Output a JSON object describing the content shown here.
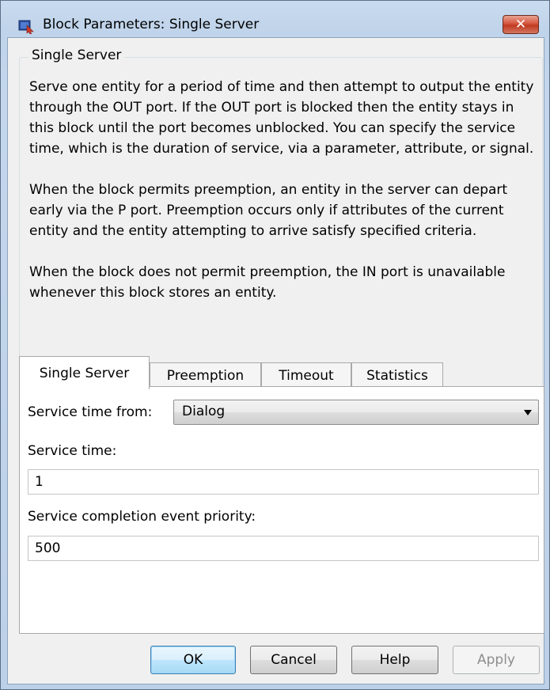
{
  "window": {
    "title": "Block Parameters: Single Server",
    "close_label": "✕"
  },
  "group": {
    "title": "Single Server",
    "paragraphs": [
      "Serve one entity for a period of time and then attempt to output the entity through the OUT port. If the OUT port is blocked then the entity stays in this block until the port becomes unblocked. You can specify the service time, which is the duration of service, via a parameter, attribute, or signal.",
      "When the block permits preemption, an entity in the server can depart early via the P port. Preemption occurs only if attributes of the current entity and the entity attempting to arrive satisfy specified criteria.",
      "When the block does not permit preemption, the IN port is unavailable whenever this block stores an entity."
    ]
  },
  "tabs": [
    {
      "label": "Single Server",
      "active": true
    },
    {
      "label": "Preemption",
      "active": false
    },
    {
      "label": "Timeout",
      "active": false
    },
    {
      "label": "Statistics",
      "active": false
    }
  ],
  "form": {
    "service_time_from_label": "Service time from:",
    "service_time_from_value": "Dialog",
    "service_time_label": "Service time:",
    "service_time_value": "1",
    "priority_label": "Service completion event priority:",
    "priority_value": "500"
  },
  "buttons": {
    "ok": "OK",
    "cancel": "Cancel",
    "help": "Help",
    "apply": "Apply"
  },
  "icons": {
    "app_icon": "simulink-block-icon",
    "dropdown": "chevron-down-icon"
  }
}
